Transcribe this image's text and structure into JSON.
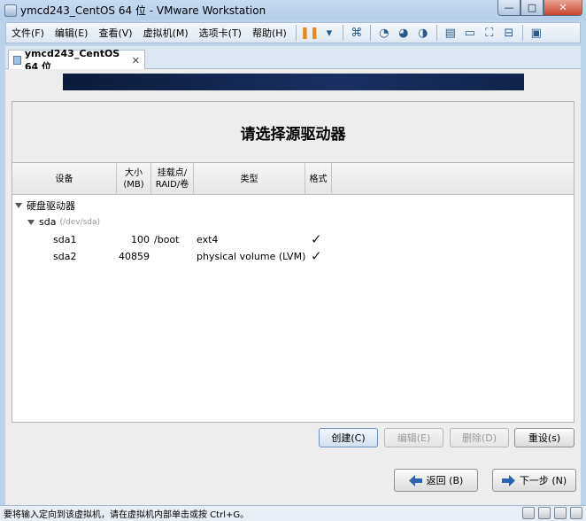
{
  "window": {
    "title": "ymcd243_CentOS 64 位 - VMware Workstation",
    "min": "—",
    "max": "□",
    "close": "✕"
  },
  "menu": [
    "文件(F)",
    "编辑(E)",
    "查看(V)",
    "虚拟机(M)",
    "选项卡(T)",
    "帮助(H)"
  ],
  "toolbar_icons": [
    "pause-icon",
    "dropdown-icon",
    "network-icon",
    "snapshot-icon",
    "snapshot-revert-icon",
    "snapshot-manager-icon",
    "sidebar-icon",
    "console-icon",
    "fullscreen-icon",
    "unity-icon",
    "view-icon"
  ],
  "tab": {
    "label": "ymcd243_CentOS 64 位",
    "close": "✕"
  },
  "page": {
    "heading": "请选择源驱动器"
  },
  "table": {
    "columns": {
      "device": "设备",
      "size": "大小\n(MB)",
      "mount": "挂载点/\nRAID/卷",
      "type": "类型",
      "format": "格式"
    },
    "group": "硬盘驱动器",
    "disk": {
      "name": "sda",
      "path": "(/dev/sda)"
    },
    "partitions": [
      {
        "device": "sda1",
        "size": "100",
        "mount": "/boot",
        "type": "ext4",
        "format": "✓"
      },
      {
        "device": "sda2",
        "size": "40859",
        "mount": "",
        "type": "physical volume (LVM)",
        "format": "✓"
      }
    ]
  },
  "actions": {
    "create": "创建(C)",
    "edit": "编辑(E)",
    "delete": "删除(D)",
    "reset": "重设(s)"
  },
  "nav": {
    "back": "返回 (B)",
    "next": "下一步 (N)"
  },
  "status": {
    "text": "要将输入定向到该虚拟机，请在虚拟机内部单击或按 Ctrl+G。"
  }
}
